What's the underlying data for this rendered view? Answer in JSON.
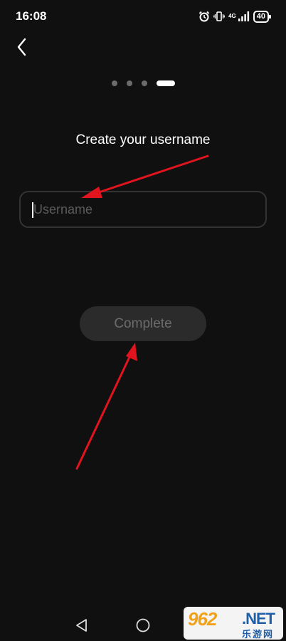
{
  "status_bar": {
    "time": "16:08",
    "network_label": "4G",
    "battery": "40",
    "icons": [
      "alarm-icon",
      "vibrate-icon",
      "signal-icon",
      "battery-icon"
    ]
  },
  "header": {
    "back_icon": "chevron-left-icon"
  },
  "pager": {
    "total_steps": 4,
    "current_step": 4
  },
  "main": {
    "title": "Create your username",
    "username_field": {
      "value": "",
      "placeholder": "Username"
    },
    "complete_label": "Complete"
  },
  "nav_bar": {
    "icons": [
      "back-triangle-icon",
      "home-circle-icon"
    ]
  },
  "watermark": {
    "logo": "962",
    "suffix": ".NET",
    "sub": "乐游网"
  },
  "colors": {
    "background": "#101010",
    "annotation_arrow": "#e0141e",
    "button_disabled_bg": "#2b2b2b",
    "button_disabled_text": "#6c6c6c"
  }
}
